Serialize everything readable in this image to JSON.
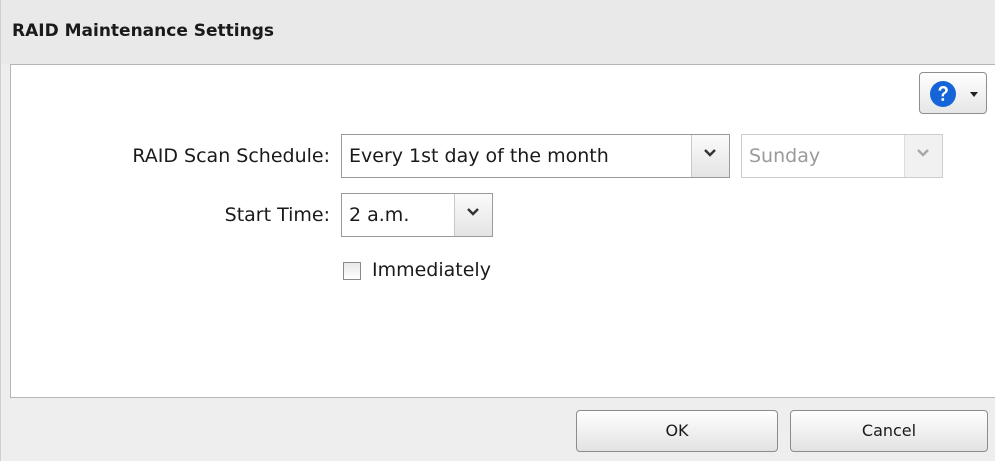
{
  "dialog": {
    "title": "RAID Maintenance Settings",
    "help_icon": "question-circle-icon",
    "accent_color": "#1565d8"
  },
  "form": {
    "scan_schedule_label": "RAID Scan Schedule:",
    "scan_schedule_value": "Every 1st day of the month",
    "weekday_value": "Sunday",
    "weekday_disabled": true,
    "start_time_label": "Start Time:",
    "start_time_value": "2 a.m.",
    "immediately_label": "Immediately",
    "immediately_checked": false
  },
  "footer": {
    "ok_label": "OK",
    "cancel_label": "Cancel"
  }
}
